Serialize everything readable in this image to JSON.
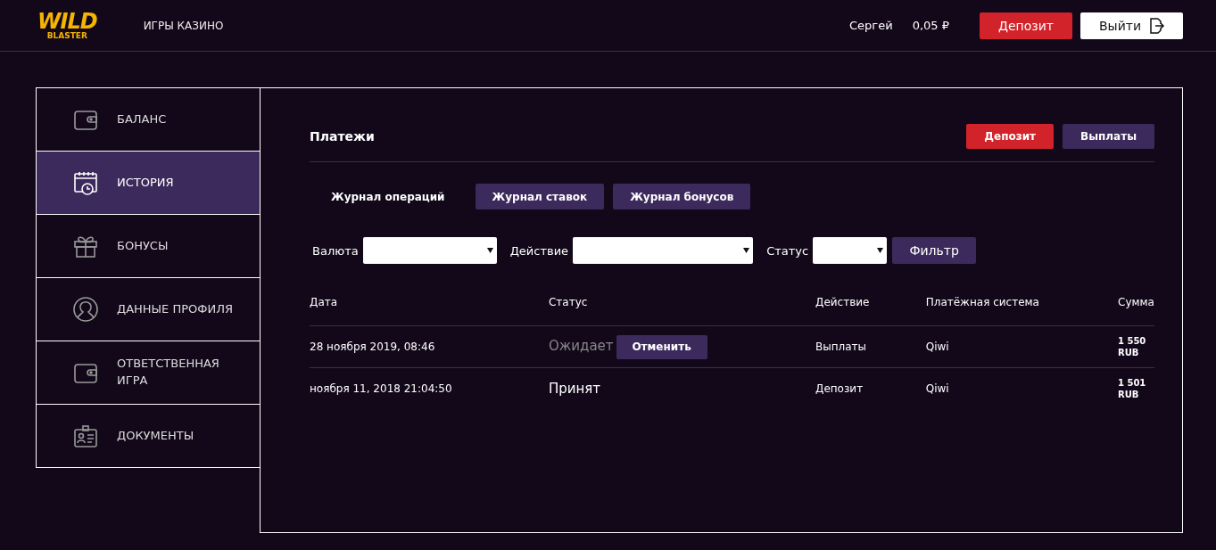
{
  "header": {
    "logo": {
      "top": "WILD",
      "bottom": "BLASTER"
    },
    "nav": "ИГРЫ КАЗИНО",
    "user": "Сергей",
    "balance": "0,05 ₽",
    "deposit_button": "Депозит",
    "logout_button": "Выйти"
  },
  "sidebar": {
    "items": [
      {
        "label": "БАЛАНС",
        "selected": false
      },
      {
        "label": "ИСТОРИЯ",
        "selected": true
      },
      {
        "label": "БОНУСЫ",
        "selected": false
      },
      {
        "label": "ДАННЫЕ ПРОФИЛЯ",
        "selected": false
      },
      {
        "label": "ОТВЕТСТВЕННАЯ ИГРА",
        "selected": false
      },
      {
        "label": "ДОКУМЕНТЫ",
        "selected": false
      }
    ]
  },
  "panel": {
    "title": "Платежи",
    "buttons": [
      {
        "label": "Депозит",
        "kind": "primary"
      },
      {
        "label": "Выплаты",
        "kind": "secondary"
      }
    ],
    "tabs": [
      {
        "label": "Журнал операций",
        "selected": true
      },
      {
        "label": "Журнал ставок",
        "selected": false
      },
      {
        "label": "Журнал бонусов",
        "selected": false
      }
    ],
    "filters": [
      {
        "label": "Валюта"
      },
      {
        "label": "Действие"
      },
      {
        "label": "Статус"
      }
    ],
    "filter_button": "Фильтр",
    "table": {
      "columns": [
        "Дата",
        "Статус",
        "Действие",
        "Платёжная система",
        "Сумма"
      ],
      "rows": [
        {
          "date": "28 ноября 2019, 08:46",
          "status": "Ожидает",
          "kind": "pending",
          "cancel_button": "Отменить",
          "action": "Выплаты",
          "system": "Qiwi",
          "amount": "1 550",
          "currency": "RUB"
        },
        {
          "date": "ноября 11, 2018 21:04:50",
          "status": "Принят",
          "kind": "accepted",
          "action": "Депозит",
          "system": "Qiwi",
          "amount": "1 501",
          "currency": "RUB"
        }
      ]
    }
  }
}
